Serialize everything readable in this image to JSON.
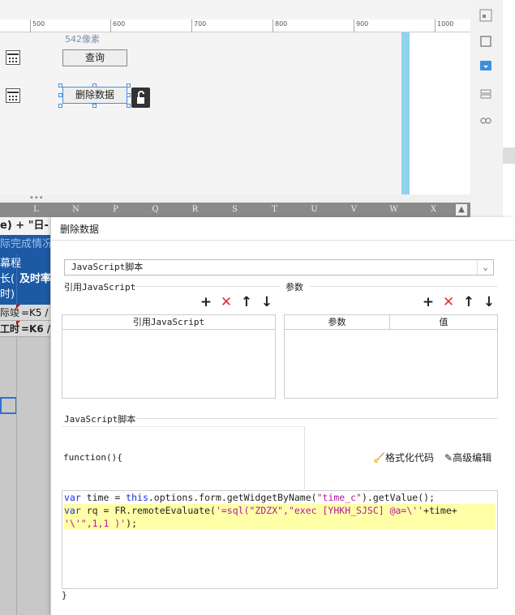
{
  "ruler": {
    "ticks": [
      "500",
      "600",
      "700",
      "800",
      "900",
      "1000"
    ]
  },
  "canvas": {
    "size_hint": "542像素",
    "query_button": "查询",
    "delete_button": "删除数据"
  },
  "sheet": {
    "columns": [
      "L",
      "N",
      "P",
      "Q",
      "R",
      "S",
      "T",
      "U",
      "V",
      "W",
      "X"
    ],
    "rowA": "e) + \"日-",
    "rowB": "际完成情况",
    "rowC": [
      "幕程",
      "长(",
      "时)"
    ],
    "rowC2": "及时率",
    "rowD": [
      "际竣",
      "=K5 /"
    ],
    "rowE": [
      "工时",
      "=K6 /"
    ]
  },
  "dialog": {
    "title": "删除数据",
    "script_type": "JavaScript脚本",
    "ref_section": "引用JavaScript",
    "param_section": "参数",
    "ref_table_header": "引用JavaScript",
    "param_headers": [
      "参数",
      "值"
    ],
    "script_section": "JavaScript脚本",
    "function_open": "function(){",
    "format_code": "格式化代码",
    "advanced_edit": "高级编辑",
    "function_close": "}",
    "code": {
      "l1_kw1": "var",
      "l1_a": " time = ",
      "l1_kw2": "this",
      "l1_b": ".options.form.getWidgetByName(",
      "l1_s": "\"time_c\"",
      "l1_c": ").getValue();",
      "l2_kw": "var",
      "l2_a": " rq = FR.remoteEvaluate(",
      "l2_s": "'=sql(\"ZDZX\",\"exec  [YHKH_SJSC] @a=\\''",
      "l2_b": "+time+",
      "l3_s": "'\\'\",1,1 )'",
      "l3_c": ");"
    }
  }
}
